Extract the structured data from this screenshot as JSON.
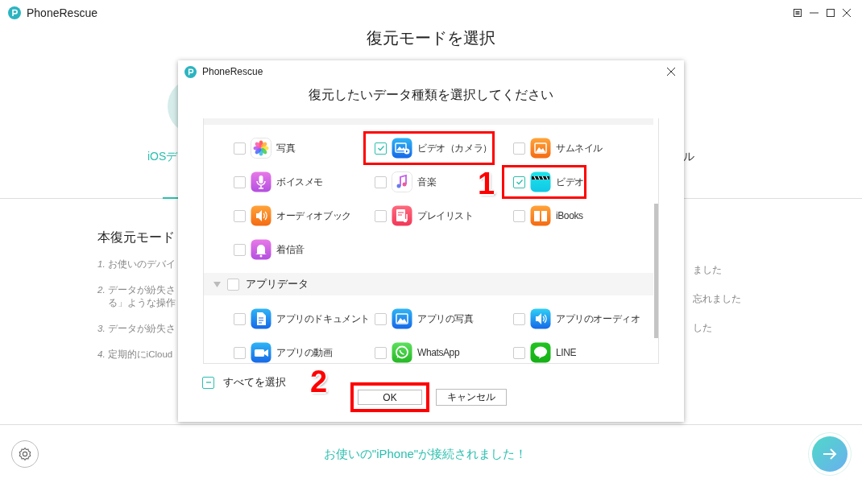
{
  "window": {
    "title": "PhoneRescue"
  },
  "page_title": "復元モードを選択",
  "modes": {
    "left_label": "iOSデ",
    "right_label": "ル"
  },
  "info": {
    "heading": "本復元モード",
    "steps": [
      {
        "number": "1.",
        "text": "お使いのデバイ"
      },
      {
        "number": "2.",
        "text": "データが紛失さ",
        "continuation": "る」ような操作"
      },
      {
        "number": "3.",
        "text": "データが紛失さ"
      },
      {
        "number": "4.",
        "text": "定期的にiCloud"
      }
    ],
    "right_notes": [
      "ました",
      "忘れました",
      "した"
    ]
  },
  "dialog": {
    "title": "PhoneRescue",
    "heading": "復元したいデータ種類を選択してください",
    "sections": [
      {
        "items": [
          {
            "label": "写真",
            "checked": false,
            "highlighted": false
          },
          {
            "label": "ビデオ（カメラ）",
            "checked": true,
            "highlighted": true
          },
          {
            "label": "サムネイル",
            "checked": false,
            "highlighted": false
          },
          {
            "label": "ボイスメモ",
            "checked": false,
            "highlighted": false
          },
          {
            "label": "音楽",
            "checked": false,
            "highlighted": false
          },
          {
            "label": "ビデオ",
            "checked": true,
            "highlighted": true
          },
          {
            "label": "オーディオブック",
            "checked": false,
            "highlighted": false
          },
          {
            "label": "プレイリスト",
            "checked": false,
            "highlighted": false
          },
          {
            "label": "iBooks",
            "checked": false,
            "highlighted": false
          },
          {
            "label": "着信音",
            "checked": false,
            "highlighted": false
          }
        ]
      },
      {
        "label": "アプリデータ",
        "checked": false,
        "expanded": true,
        "items": [
          {
            "label": "アプリのドキュメント",
            "checked": false,
            "highlighted": false
          },
          {
            "label": "アプリの写真",
            "checked": false,
            "highlighted": false
          },
          {
            "label": "アプリのオーディオ",
            "checked": false,
            "highlighted": false
          },
          {
            "label": "アプリの動画",
            "checked": false,
            "highlighted": false
          },
          {
            "label": "WhatsApp",
            "checked": false,
            "highlighted": false
          },
          {
            "label": "LINE",
            "checked": false,
            "highlighted": false
          }
        ]
      }
    ],
    "select_all": {
      "label": "すべてを選択",
      "partial": true
    },
    "buttons": [
      {
        "label": "OK",
        "highlighted": true
      },
      {
        "label": "キャンセル",
        "highlighted": false
      }
    ],
    "annotations": [
      {
        "label": "1"
      },
      {
        "label": "2"
      }
    ]
  },
  "status": "お使いの\"iPhone\"が接続されました！"
}
